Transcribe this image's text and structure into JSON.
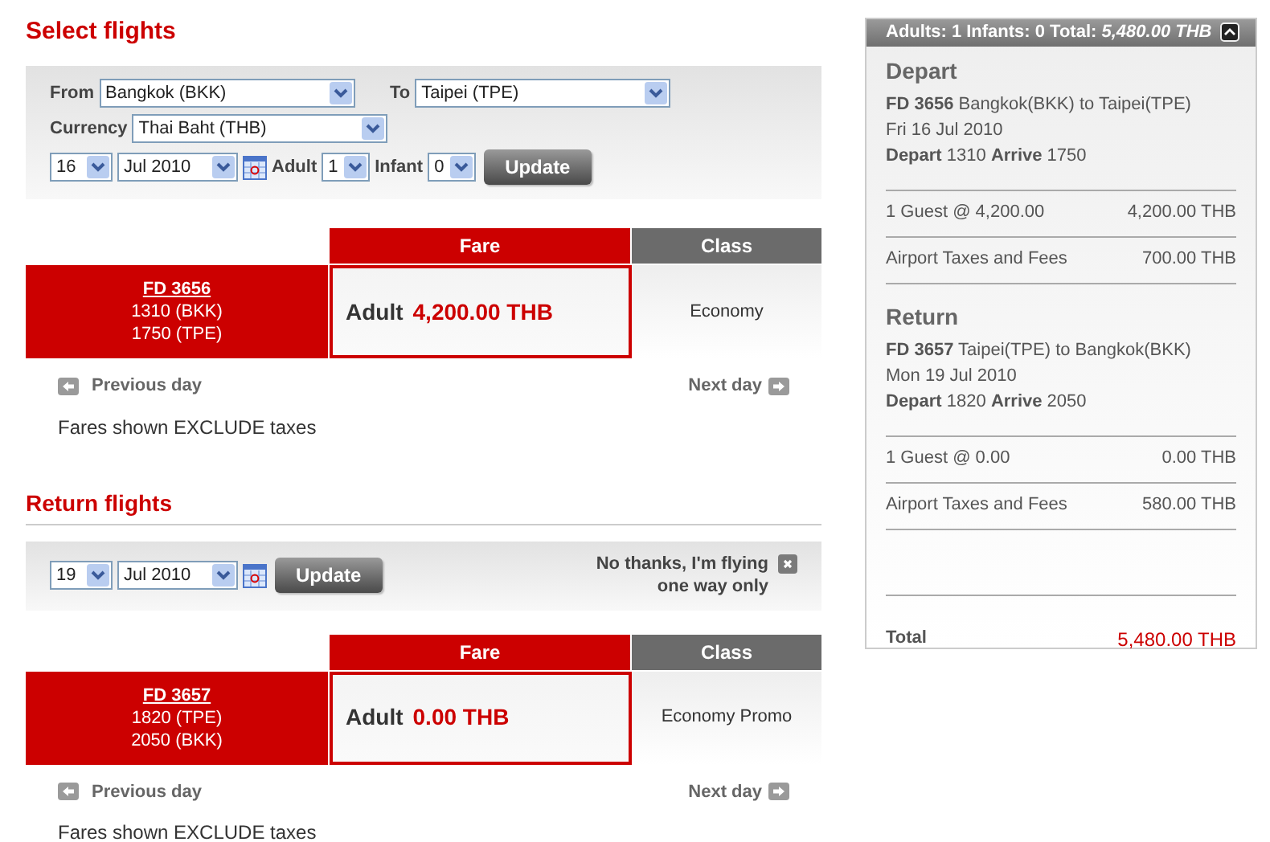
{
  "outbound": {
    "title": "Select flights",
    "from": {
      "label": "From",
      "value": "Bangkok (BKK)"
    },
    "to": {
      "label": "To",
      "value": "Taipei (TPE)"
    },
    "currency": {
      "label": "Currency",
      "value": "Thai Baht (THB)"
    },
    "day": "16",
    "month": "Jul 2010",
    "adult": {
      "label": "Adult",
      "value": "1"
    },
    "infant": {
      "label": "Infant",
      "value": "0"
    },
    "update": "Update",
    "columns": [
      "Fare",
      "Class"
    ],
    "flight": {
      "number": "FD 3656",
      "depart": "1310 (BKK)",
      "arrive": "1750 (TPE)",
      "fare_label": "Adult",
      "fare_value": "4,200.00 THB",
      "class": "Economy"
    },
    "previous_day": "Previous day",
    "next_day": "Next day",
    "note": "Fares shown EXCLUDE taxes"
  },
  "return": {
    "title": "Return flights",
    "day": "19",
    "month": "Jul 2010",
    "update": "Update",
    "one_way": "No thanks, I'm flying one way only",
    "columns": [
      "Fare",
      "Class"
    ],
    "flight": {
      "number": "FD 3657",
      "depart": "1820 (TPE)",
      "arrive": "2050 (BKK)",
      "fare_label": "Adult",
      "fare_value": "0.00 THB",
      "class": "Economy Promo"
    },
    "previous_day": "Previous day",
    "next_day": "Next day",
    "note": "Fares shown EXCLUDE taxes"
  },
  "summary": {
    "header": "Adults: 1 Infants: 0 Total: *5,480.00 THB*",
    "legs": [
      {
        "title": "Depart",
        "flight_number": "FD 3656",
        "route": "Bangkok(BKK) to Taipei(TPE)",
        "date": "Fri 16 Jul 2010",
        "depart_label": "Depart",
        "depart_time": "1310",
        "arrive_label": "Arrive",
        "arrive_time": "1750",
        "lines": [
          {
            "label": "1 Guest @ 4,200.00",
            "amount": "4,200.00 THB"
          },
          {
            "label": "Airport Taxes and Fees",
            "amount": "700.00 THB"
          }
        ]
      },
      {
        "title": "Return",
        "flight_number": "FD 3657",
        "route": "Taipei(TPE) to Bangkok(BKK)",
        "date": "Mon 19 Jul 2010",
        "depart_label": "Depart",
        "depart_time": "1820",
        "arrive_label": "Arrive",
        "arrive_time": "2050",
        "lines": [
          {
            "label": "1 Guest @ 0.00",
            "amount": "0.00 THB"
          },
          {
            "label": "Airport Taxes and Fees",
            "amount": "580.00 THB"
          }
        ]
      }
    ],
    "total_label": "Total",
    "total_value": "5,480.00 THB"
  }
}
